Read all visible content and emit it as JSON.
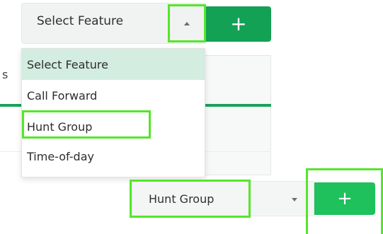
{
  "feature_select": {
    "value": "Select Feature",
    "add_label": "+"
  },
  "feature_dropdown": {
    "options": [
      {
        "label": "Select Feature",
        "selected": true
      },
      {
        "label": "Call Forward",
        "selected": false
      },
      {
        "label": "Hunt Group",
        "selected": false,
        "highlighted": true
      },
      {
        "label": "Time-of-day",
        "selected": false
      }
    ]
  },
  "background_stub": {
    "label": "s"
  },
  "feature_select_result": {
    "value": "Hunt Group",
    "add_label": "+"
  },
  "colors": {
    "highlight": "#55e62a",
    "primary_green": "#13a155",
    "bright_green": "#1ec15c",
    "selected_option_bg": "#d3ede0"
  }
}
